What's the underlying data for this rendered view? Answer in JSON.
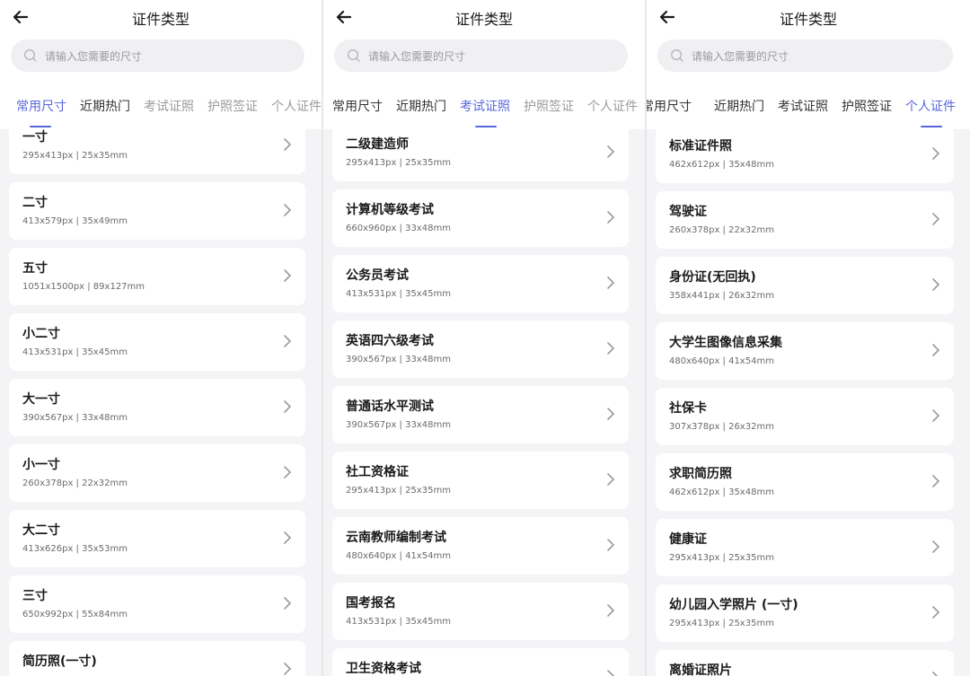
{
  "screens": [
    {
      "title": "证件类型",
      "search_placeholder": "请输入您需要的尺寸",
      "tabs": [
        "常用尺寸",
        "近期热门",
        "考试证照",
        "护照签证",
        "个人证件"
      ],
      "active_tab": 0,
      "items": [
        {
          "name": "一寸",
          "spec": "295x413px | 25x35mm"
        },
        {
          "name": "二寸",
          "spec": "413x579px | 35x49mm"
        },
        {
          "name": "五寸",
          "spec": "1051x1500px | 89x127mm"
        },
        {
          "name": "小二寸",
          "spec": "413x531px | 35x45mm"
        },
        {
          "name": "大一寸",
          "spec": "390x567px | 33x48mm"
        },
        {
          "name": "小一寸",
          "spec": "260x378px | 22x32mm"
        },
        {
          "name": "大二寸",
          "spec": "413x626px | 35x53mm"
        },
        {
          "name": "三寸",
          "spec": "650x992px | 55x84mm"
        },
        {
          "name": "简历照(一寸)",
          "spec": ""
        }
      ]
    },
    {
      "title": "证件类型",
      "search_placeholder": "请输入您需要的尺寸",
      "tabs": [
        "常用尺寸",
        "近期热门",
        "考试证照",
        "护照签证",
        "个人证件"
      ],
      "active_tab": 2,
      "items": [
        {
          "name": "二级建造师",
          "spec": "295x413px | 25x35mm"
        },
        {
          "name": "计算机等级考试",
          "spec": "660x960px | 33x48mm"
        },
        {
          "name": "公务员考试",
          "spec": "413x531px | 35x45mm"
        },
        {
          "name": "英语四六级考试",
          "spec": "390x567px | 33x48mm"
        },
        {
          "name": "普通话水平测试",
          "spec": "390x567px | 33x48mm"
        },
        {
          "name": "社工资格证",
          "spec": "295x413px | 25x35mm"
        },
        {
          "name": "云南教师编制考试",
          "spec": "480x640px | 41x54mm"
        },
        {
          "name": "国考报名",
          "spec": "413x531px | 35x45mm"
        },
        {
          "name": "卫生资格考试",
          "spec": ""
        }
      ]
    },
    {
      "title": "证件类型",
      "search_placeholder": "请输入您需要的尺寸",
      "tabs": [
        "常用尺寸",
        "近期热门",
        "考试证照",
        "护照签证",
        "个人证件"
      ],
      "active_tab": 4,
      "items": [
        {
          "name": "标准证件照",
          "spec": "462x612px | 35x48mm"
        },
        {
          "name": "驾驶证",
          "spec": "260x378px | 22x32mm"
        },
        {
          "name": "身份证(无回执)",
          "spec": "358x441px | 26x32mm"
        },
        {
          "name": "大学生图像信息采集",
          "spec": "480x640px | 41x54mm"
        },
        {
          "name": "社保卡",
          "spec": "307x378px | 26x32mm"
        },
        {
          "name": "求职简历照",
          "spec": "462x612px | 35x48mm"
        },
        {
          "name": "健康证",
          "spec": "295x413px | 25x35mm"
        },
        {
          "name": "幼儿园入学照片 (一寸)",
          "spec": "295x413px | 25x35mm"
        },
        {
          "name": "离婚证照片",
          "spec": ""
        }
      ]
    }
  ],
  "colors": {
    "accent": "#5867dd",
    "background": "#f4f4f6",
    "card": "#ffffff"
  },
  "icons": {
    "back": "arrow-left-icon",
    "search": "search-icon",
    "chevron": "chevron-right-icon"
  }
}
